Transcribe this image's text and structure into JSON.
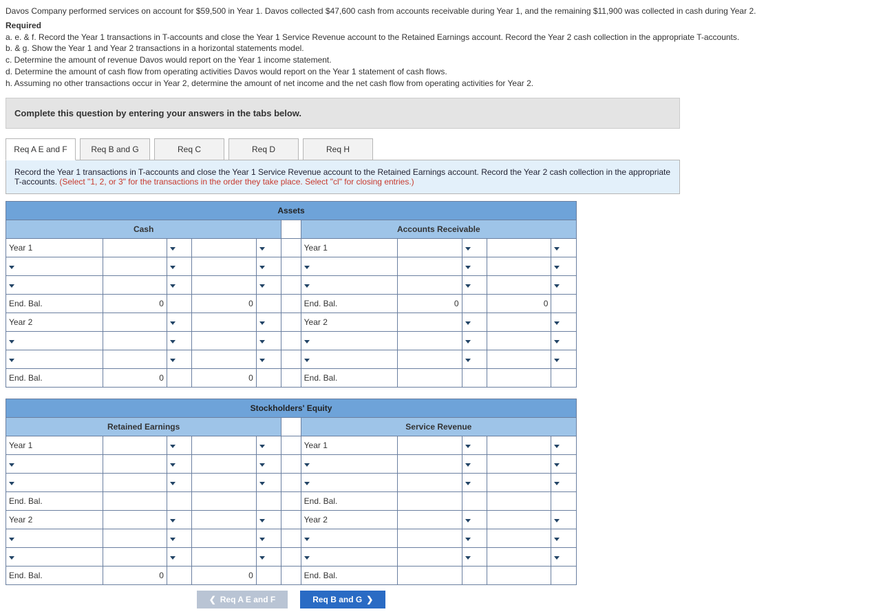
{
  "problem": {
    "intro": "Davos Company performed services on account for $59,500 in Year 1. Davos collected $47,600 cash from accounts receivable during Year 1, and the remaining $11,900 was collected in cash during Year 2.",
    "required_label": "Required",
    "items": {
      "a": "a. e. & f. Record the Year 1 transactions in T-accounts and close the Year 1 Service Revenue account to the Retained Earnings account. Record the Year 2 cash collection in the appropriate T-accounts.",
      "b": "b. & g. Show the Year 1 and Year 2 transactions in a horizontal statements model.",
      "c": "c. Determine the amount of revenue Davos would report on the Year 1 income statement.",
      "d": "d. Determine the amount of cash flow from operating activities Davos would report on the Year 1 statement of cash flows.",
      "h": "h. Assuming no other transactions occur in Year 2, determine the amount of net income and the net cash flow from operating activities for Year 2."
    }
  },
  "banner": "Complete this question by entering your answers in the tabs below.",
  "tabs": {
    "t1": "Req A E and F",
    "t2": "Req B and G",
    "t3": "Req C",
    "t4": "Req D",
    "t5": "Req H"
  },
  "panel": {
    "main": "Record the Year 1 transactions in T-accounts and close the Year 1 Service Revenue account to the Retained Earnings account. Record the Year 2 cash collection in the appropriate T-accounts. ",
    "hint": "(Select \"1, 2, or 3\" for the transactions in the order they take place. Select \"cl\" for closing entries.)"
  },
  "sections": {
    "assets": "Assets",
    "equity": "Stockholders' Equity"
  },
  "accounts": {
    "cash": "Cash",
    "ar": "Accounts Receivable",
    "re": "Retained Earnings",
    "sr": "Service Revenue"
  },
  "labels": {
    "year1": "Year 1",
    "year2": "Year 2",
    "endbal": "End. Bal."
  },
  "values": {
    "zero": "0",
    "blank": ""
  },
  "nav": {
    "prev": "Req A E and F",
    "next": "Req B and G"
  }
}
